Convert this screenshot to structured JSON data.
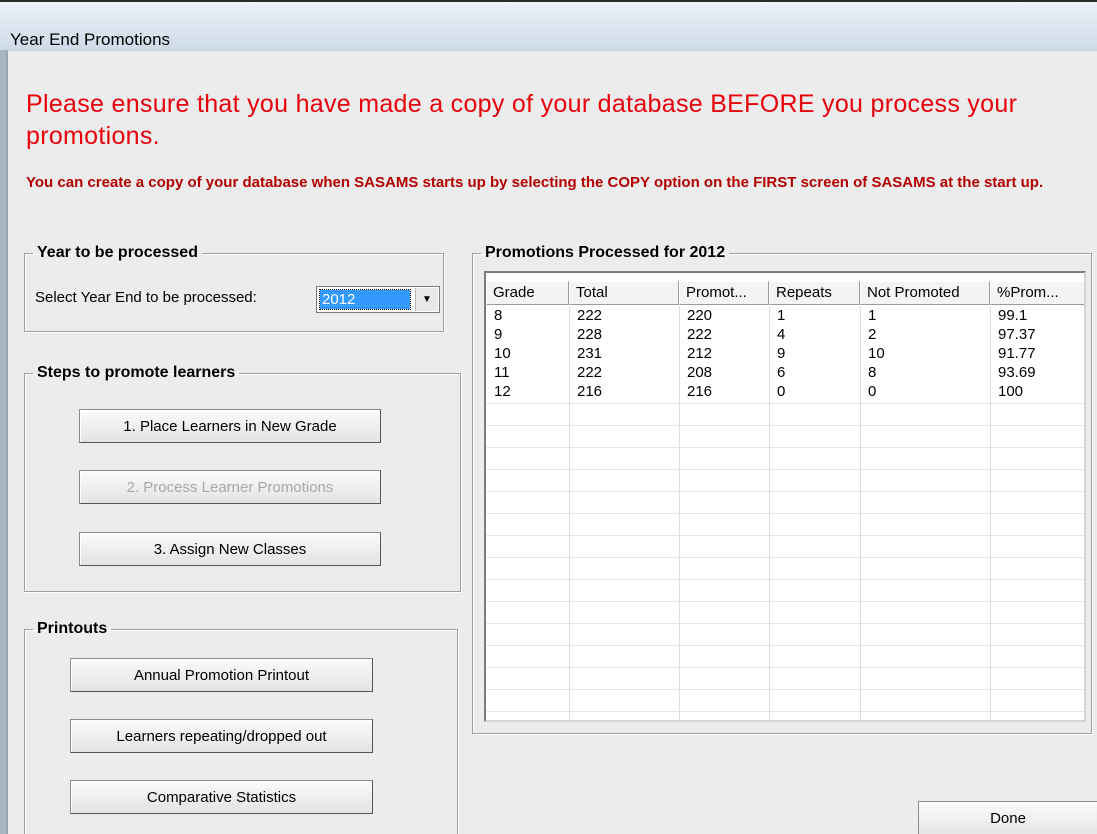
{
  "window": {
    "title": "Year End Promotions"
  },
  "warnings": {
    "primary": "Please ensure that you have made a copy of your database BEFORE you process your promotions.",
    "secondary": "You can create a copy of your database when SASAMS starts up by selecting the COPY option on the FIRST screen of SASAMS at the start up."
  },
  "year_group": {
    "legend": "Year to be processed",
    "label": "Select Year End to be processed:",
    "selected": "2012"
  },
  "steps_group": {
    "legend": "Steps to promote learners",
    "buttons": [
      {
        "label": "1. Place Learners in New Grade",
        "enabled": true
      },
      {
        "label": "2. Process Learner Promotions",
        "enabled": false
      },
      {
        "label": "3. Assign New Classes",
        "enabled": true
      }
    ]
  },
  "printouts_group": {
    "legend": "Printouts",
    "buttons": [
      {
        "label": "Annual Promotion Printout"
      },
      {
        "label": "Learners repeating/dropped out"
      },
      {
        "label": "Comparative Statistics"
      }
    ]
  },
  "promotions": {
    "legend": "Promotions Processed for 2012",
    "columns": [
      "Grade",
      "Total",
      "Promot...",
      "Repeats",
      "Not Promoted",
      "%Prom..."
    ],
    "rows": [
      [
        "8",
        "222",
        "220",
        "1",
        "1",
        "99.1"
      ],
      [
        "9",
        "228",
        "222",
        "4",
        "2",
        "97.37"
      ],
      [
        "10",
        "231",
        "212",
        "9",
        "10",
        "91.77"
      ],
      [
        "11",
        "222",
        "208",
        "6",
        "8",
        "93.69"
      ],
      [
        "12",
        "216",
        "216",
        "0",
        "0",
        "100"
      ]
    ]
  },
  "done_label": "Done"
}
